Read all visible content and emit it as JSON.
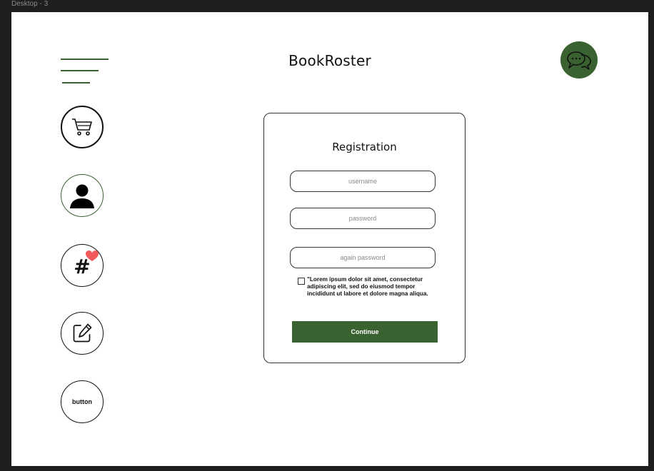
{
  "frame": {
    "label": "Desktop - 3"
  },
  "header": {
    "title": "BookRoster",
    "menu_icon": "hamburger-menu-icon",
    "chat_icon": "chat-bubbles-icon"
  },
  "sidebar": {
    "items": [
      {
        "name": "cart",
        "icon": "shopping-cart-icon"
      },
      {
        "name": "profile",
        "icon": "user-icon"
      },
      {
        "name": "hashtag",
        "icon": "hashtag-heart-icon"
      },
      {
        "name": "edit",
        "icon": "edit-icon"
      },
      {
        "name": "generic",
        "label": "button"
      }
    ]
  },
  "registration": {
    "title": "Registration",
    "username_placeholder": "username",
    "password_placeholder": "password",
    "again_password_placeholder": "again password",
    "terms_text": "\"Lorem ipsum dolor sit amet, consectetur adipiscing elit, sed do eiusmod tempor incididunt ut labore et dolore magna aliqua.",
    "terms_checked": false,
    "continue_label": "Continue"
  },
  "colors": {
    "accent": "#3a6130",
    "background": "#1e1e1e",
    "canvas": "#ffffff",
    "heart": "#f05a5a"
  }
}
